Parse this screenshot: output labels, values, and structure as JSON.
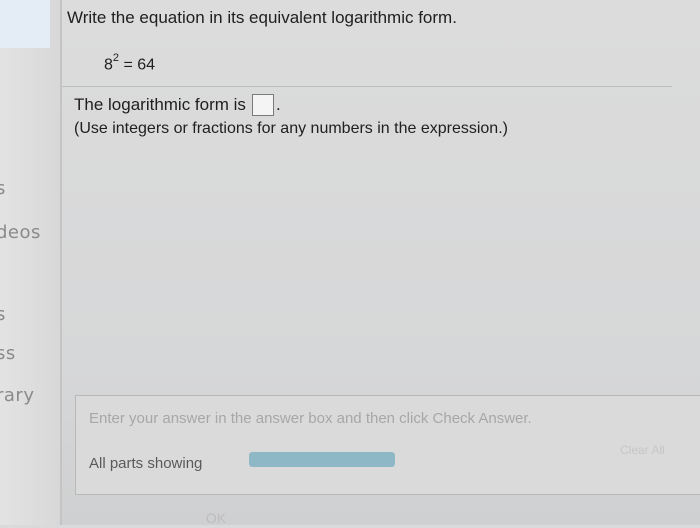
{
  "sidebar": {
    "items": [
      {
        "label": "s"
      },
      {
        "label": "deos"
      },
      {
        "label": "s"
      },
      {
        "label": "ss"
      },
      {
        "label": "rary"
      }
    ]
  },
  "question": {
    "prompt": "Write the equation in its equivalent logarithmic form.",
    "equation": {
      "base": "8",
      "exponent": "2",
      "rest": " = 64"
    }
  },
  "answer": {
    "label": "The logarithmic form is",
    "value": "",
    "end": ".",
    "hint": "(Use integers or fractions for any numbers in the expression.)"
  },
  "footer": {
    "instruction": "Enter your answer in the answer box and then click Check Answer.",
    "parts_label": "All parts showing",
    "progress": 1.0,
    "clear_all_label": "Clear All",
    "ok_label": "OK"
  }
}
